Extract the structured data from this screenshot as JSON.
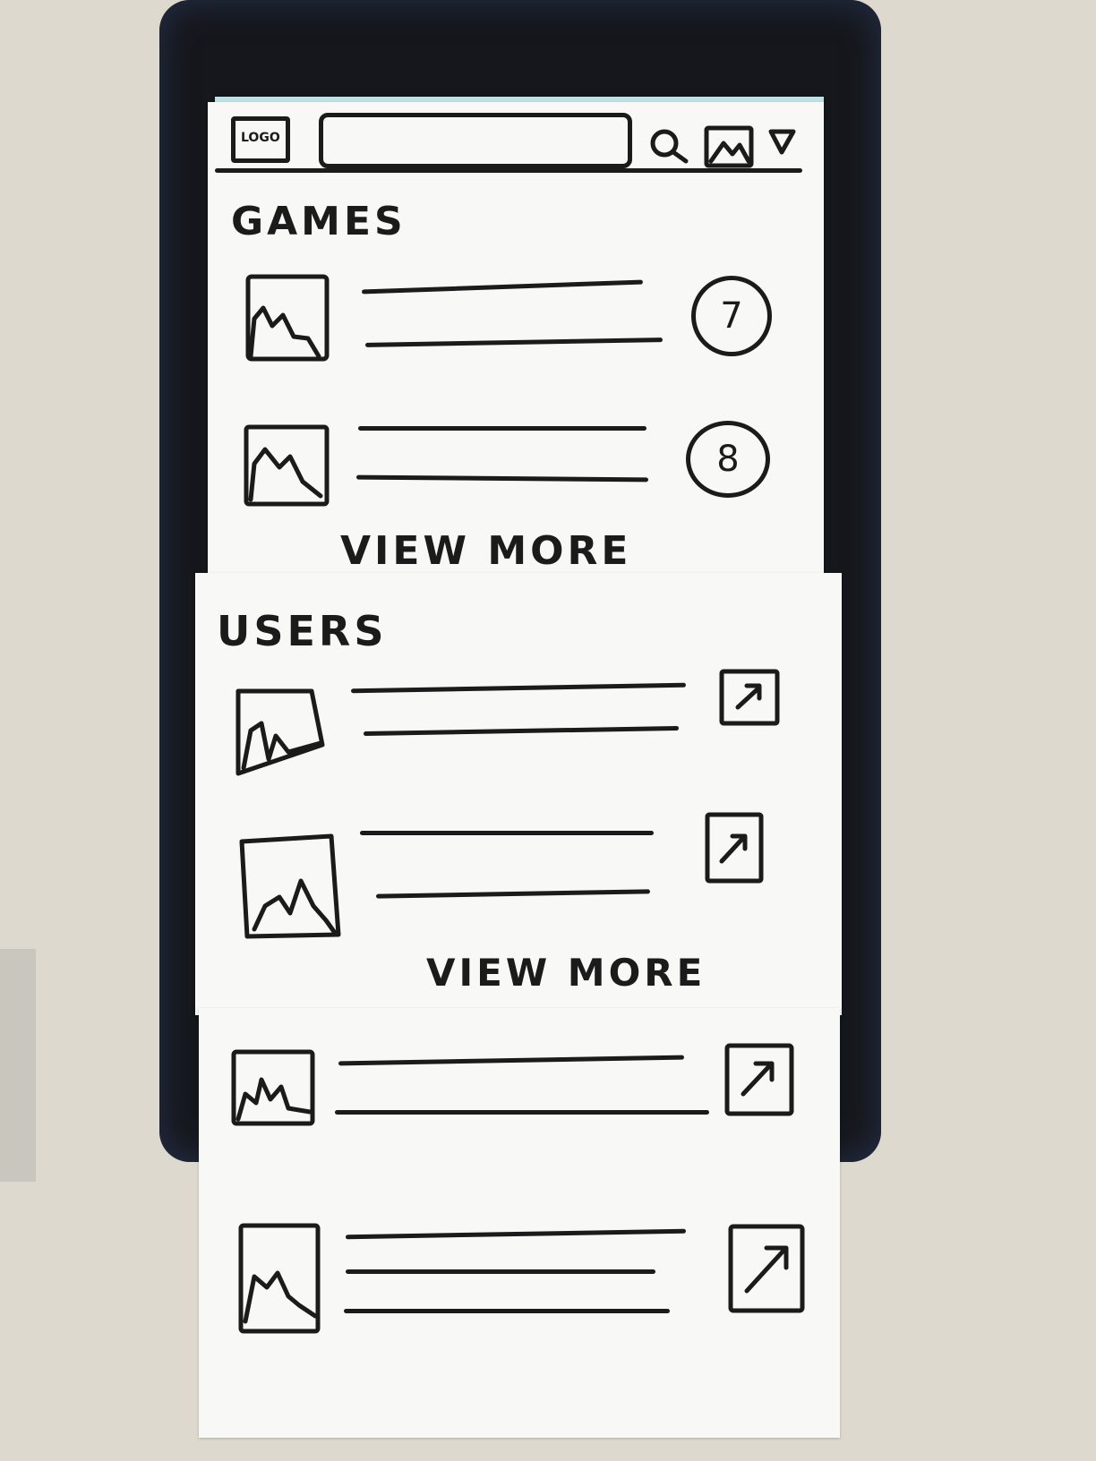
{
  "header": {
    "logo_text": "LOGO",
    "search_placeholder": "",
    "icons": [
      "search-icon",
      "image-icon",
      "dropdown-icon"
    ]
  },
  "games": {
    "title": "GAMES",
    "items": [
      {
        "badge": "7"
      },
      {
        "badge": "8"
      }
    ],
    "view_more": "VIEW MORE"
  },
  "users": {
    "title": "USERS",
    "items": [
      {
        "action_icon": "external-link-icon"
      },
      {
        "action_icon": "external-link-icon"
      }
    ],
    "view_more": "VIEW MORE"
  },
  "more_items": [
    {
      "action_icon": "external-link-icon"
    },
    {
      "action_icon": "external-link-icon"
    }
  ]
}
